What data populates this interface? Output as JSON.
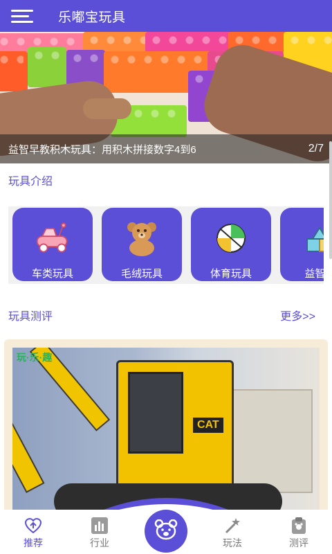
{
  "header": {
    "title": "乐嘟宝玩具",
    "menu_icon": "hamburger-menu-icon"
  },
  "banner": {
    "caption": "益智早教积木玩具：用积木拼接数字4到6",
    "index": "2/7"
  },
  "intro": {
    "title": "玩具介绍",
    "categories": [
      {
        "label": "车类玩具",
        "icon": "toy-car-icon"
      },
      {
        "label": "毛绒玩具",
        "icon": "teddy-bear-icon"
      },
      {
        "label": "体育玩具",
        "icon": "ball-icon"
      },
      {
        "label": "益智玩",
        "icon": "puzzle-blocks-icon"
      }
    ]
  },
  "review": {
    "title": "玩具测评",
    "more": "更多>>",
    "watermark": "玩·乐·趣",
    "badge": "CAT"
  },
  "nav": {
    "items": [
      {
        "label": "推荐",
        "icon": "recommend-icon",
        "active": true
      },
      {
        "label": "行业",
        "icon": "industry-icon",
        "active": false
      },
      {
        "label": "",
        "icon": "bear-face-icon",
        "active": false
      },
      {
        "label": "玩法",
        "icon": "magic-wand-icon",
        "active": false
      },
      {
        "label": "测评",
        "icon": "clipboard-icon",
        "active": false
      }
    ]
  },
  "colors": {
    "primary": "#5a4fd6",
    "card_bg": "#f6ecd8",
    "inactive": "#777777"
  }
}
